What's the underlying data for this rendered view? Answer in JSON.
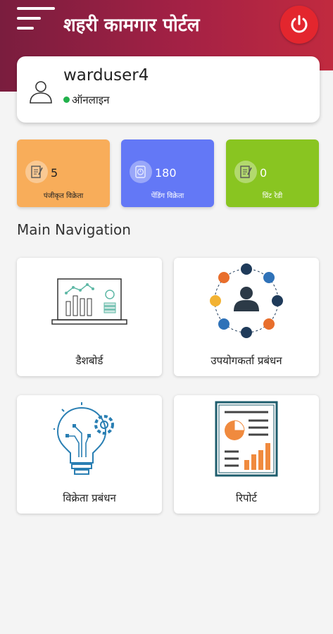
{
  "header": {
    "title": "शहरी कामगार पोर्टल",
    "menu_icon": "hamburger-icon",
    "power_icon": "power-icon"
  },
  "user": {
    "username": "warduser4",
    "status": "ऑनलाइन",
    "status_color": "#22b14c"
  },
  "stats": [
    {
      "count": "5",
      "label": "पंजीकृत विक्रेता",
      "color": "#f8ad5a"
    },
    {
      "count": "180",
      "label": "पेंडिंग विक्रेता",
      "color": "#6378f6"
    },
    {
      "count": "0",
      "label": "प्रिंट रेडी",
      "color": "#89c521"
    }
  ],
  "nav": {
    "title": "Main Navigation",
    "items": [
      {
        "label": "डैशबोर्ड",
        "icon": "dashboard-laptop-icon"
      },
      {
        "label": "उपयोगकर्ता प्रबंधन",
        "icon": "user-network-icon"
      },
      {
        "label": "विक्रेता प्रबंधन",
        "icon": "idea-bulb-icon"
      },
      {
        "label": "रिपोर्ट",
        "icon": "report-icon"
      }
    ]
  },
  "colors": {
    "header_start": "#7a1d3e",
    "header_end": "#c12a3f",
    "power_button": "#e3262e"
  }
}
